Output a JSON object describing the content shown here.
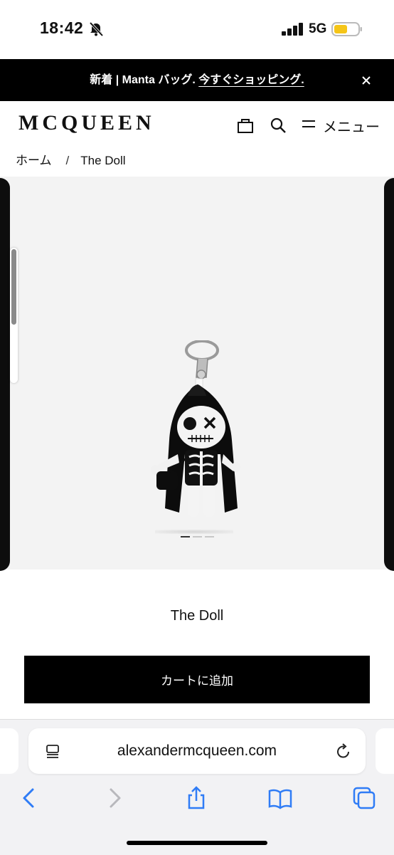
{
  "status": {
    "time": "18:42",
    "network": "5G"
  },
  "promo": {
    "prefix": "新着 | Manta バッグ. ",
    "link": "今すぐショッピング."
  },
  "header": {
    "logo": "MCQUEEN",
    "menu_label": "メニュー"
  },
  "breadcrumb": {
    "home": "ホーム",
    "separator": "/",
    "current": "The Doll"
  },
  "gallery": {
    "slide_count": 3,
    "active_slide": 1
  },
  "product": {
    "name": "The Doll",
    "add_to_cart": "カートに追加"
  },
  "browser": {
    "url": "alexandermcqueen.com"
  },
  "colors": {
    "accent": "#000000",
    "ios_blue": "#2f7cf6",
    "gallery_bg": "#f3f3f3"
  }
}
